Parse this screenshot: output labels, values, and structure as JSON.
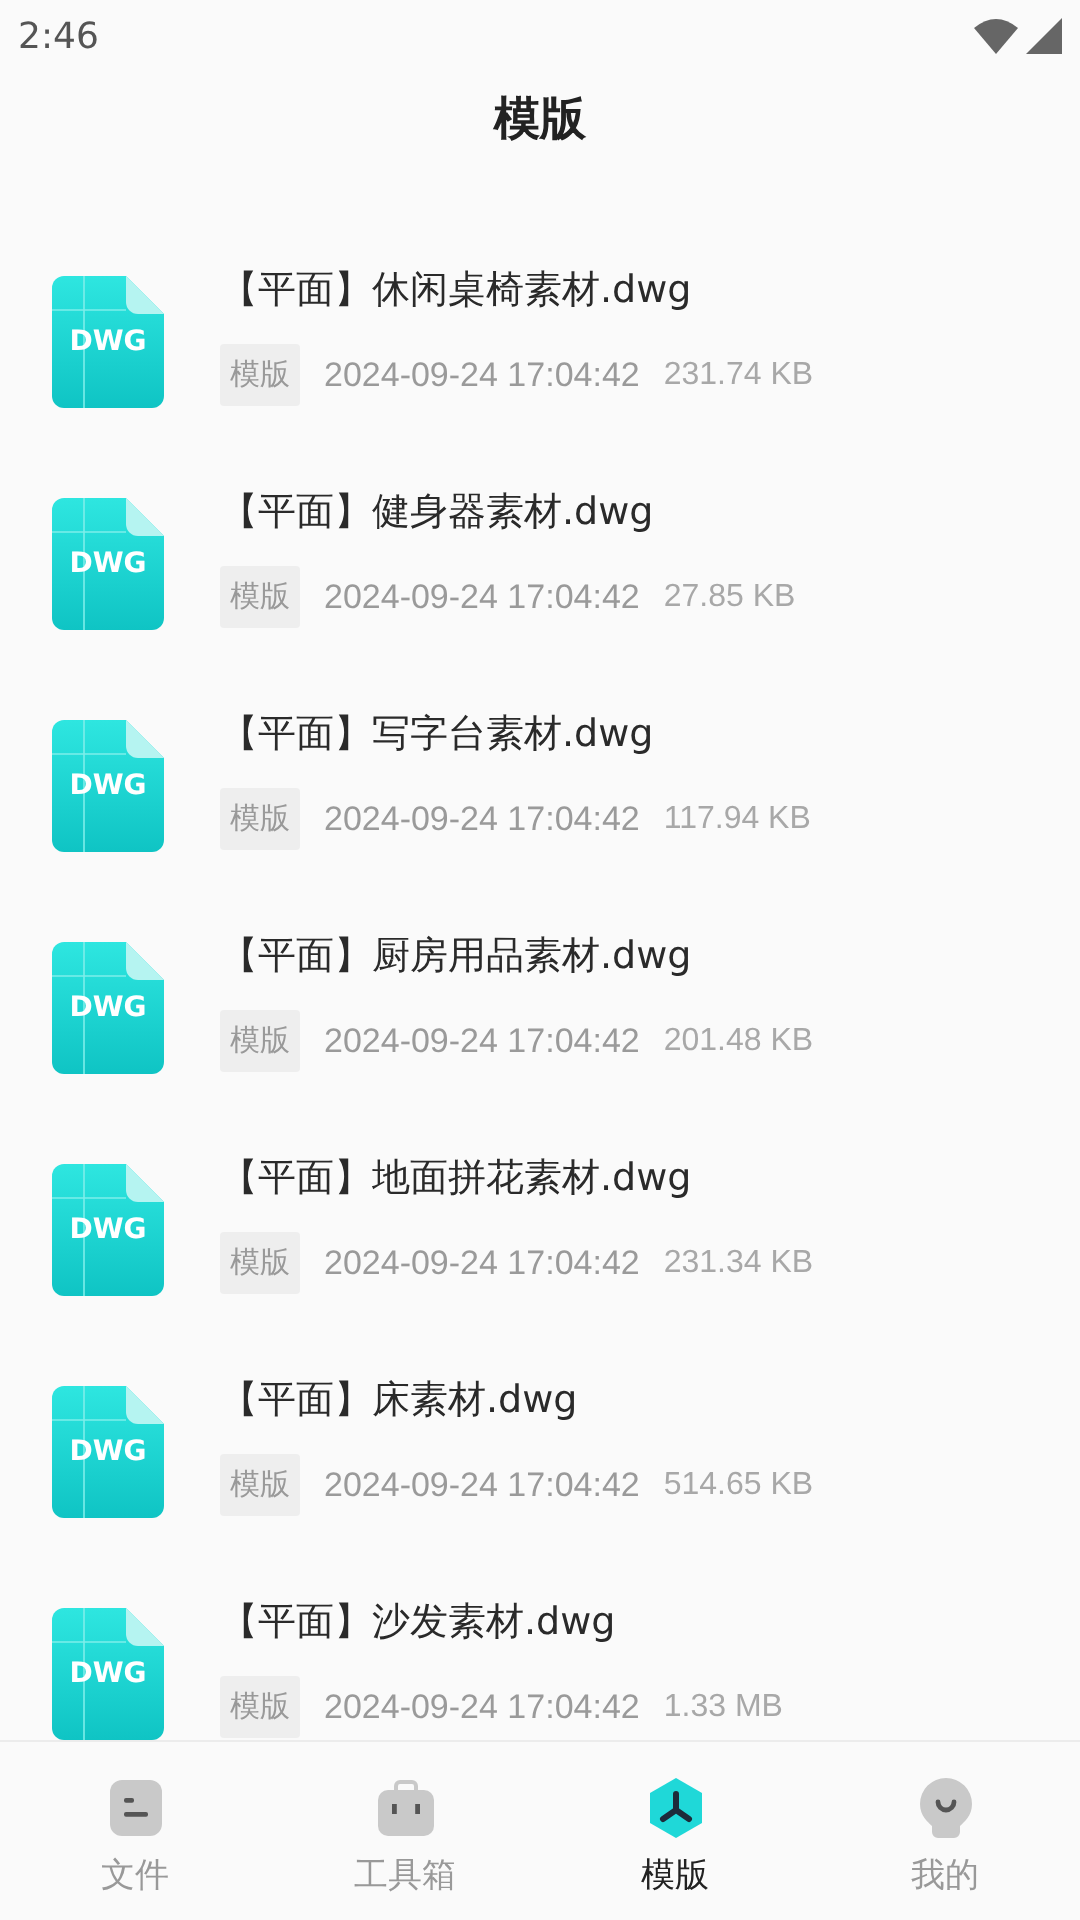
{
  "status_bar": {
    "time": "2:46"
  },
  "title": "模版",
  "files": [
    {
      "icon_label": "DWG",
      "name": "【平面】休闲桌椅素材.dwg",
      "tag": "模版",
      "date": "2024-09-24 17:04:42",
      "size": "231.74 KB"
    },
    {
      "icon_label": "DWG",
      "name": "【平面】健身器素材.dwg",
      "tag": "模版",
      "date": "2024-09-24 17:04:42",
      "size": "27.85 KB"
    },
    {
      "icon_label": "DWG",
      "name": "【平面】写字台素材.dwg",
      "tag": "模版",
      "date": "2024-09-24 17:04:42",
      "size": "117.94 KB"
    },
    {
      "icon_label": "DWG",
      "name": "【平面】厨房用品素材.dwg",
      "tag": "模版",
      "date": "2024-09-24 17:04:42",
      "size": "201.48 KB"
    },
    {
      "icon_label": "DWG",
      "name": "【平面】地面拼花素材.dwg",
      "tag": "模版",
      "date": "2024-09-24 17:04:42",
      "size": "231.34 KB"
    },
    {
      "icon_label": "DWG",
      "name": "【平面】床素材.dwg",
      "tag": "模版",
      "date": "2024-09-24 17:04:42",
      "size": "514.65 KB"
    },
    {
      "icon_label": "DWG",
      "name": "【平面】沙发素材.dwg",
      "tag": "模版",
      "date": "2024-09-24 17:04:42",
      "size": "1.33 MB"
    }
  ],
  "tabs": [
    {
      "kind": "file",
      "label": "文件",
      "selected": false
    },
    {
      "kind": "toolbox",
      "label": "工具箱",
      "selected": false
    },
    {
      "kind": "template",
      "label": "模版",
      "selected": true
    },
    {
      "kind": "profile",
      "label": "我的",
      "selected": false
    }
  ]
}
